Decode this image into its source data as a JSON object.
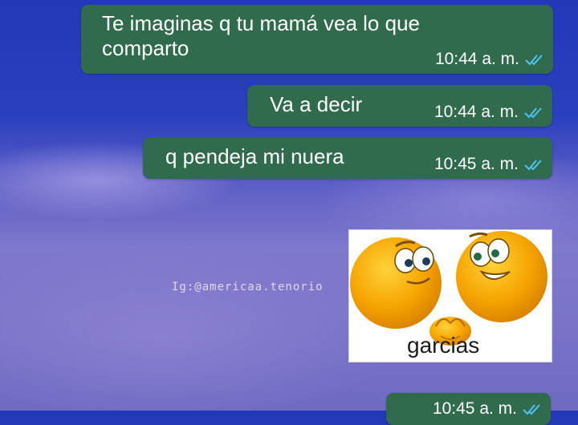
{
  "messages": [
    {
      "text": "Te imaginas q tu mamá vea lo que comparto",
      "time": "10:44 a. m.",
      "status": "read"
    },
    {
      "text": "Va a decir",
      "time": "10:44 a. m.",
      "status": "read"
    },
    {
      "text": "q pendeja mi nuera",
      "time": "10:45 a. m.",
      "status": "read"
    },
    {
      "text": "",
      "time": "10:45 a. m.",
      "status": "read"
    }
  ],
  "sticker": {
    "caption": "garcias"
  },
  "watermark": "Ig:@americaa.tenorio",
  "colors": {
    "bubble": "#2f6b4c",
    "read_ticks": "#4fc3f7",
    "emoji": "#f5a400"
  },
  "icons": {
    "read_receipt": "double-check-icon"
  }
}
